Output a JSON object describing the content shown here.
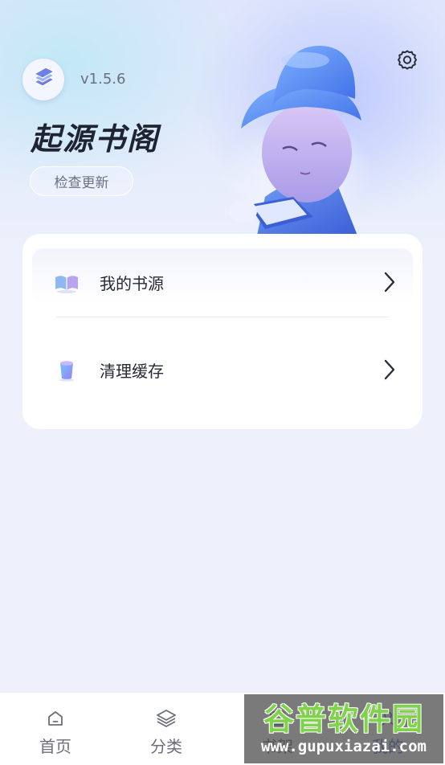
{
  "header": {
    "version": "v1.5.6",
    "app_title": "起源书阁",
    "check_update_label": "检查更新",
    "logo_icon": "stacked-books-icon",
    "settings_icon": "gear-icon"
  },
  "menu": {
    "items": [
      {
        "label": "我的书源",
        "icon": "open-book-icon"
      },
      {
        "label": "清理缓存",
        "icon": "trash-bin-icon"
      }
    ]
  },
  "tabbar": {
    "tabs": [
      {
        "label": "首页",
        "icon": "home-icon"
      },
      {
        "label": "分类",
        "icon": "layers-icon"
      },
      {
        "label": "书架",
        "icon": "bookshelf-icon"
      },
      {
        "label": "我的",
        "icon": "user-icon"
      }
    ]
  },
  "watermark": {
    "main": "谷普软件园",
    "sub": "www.gupuxiazai.com"
  },
  "colors": {
    "accent": "#5b6fd6",
    "title": "#1f2433",
    "background": "#eef1fb"
  }
}
